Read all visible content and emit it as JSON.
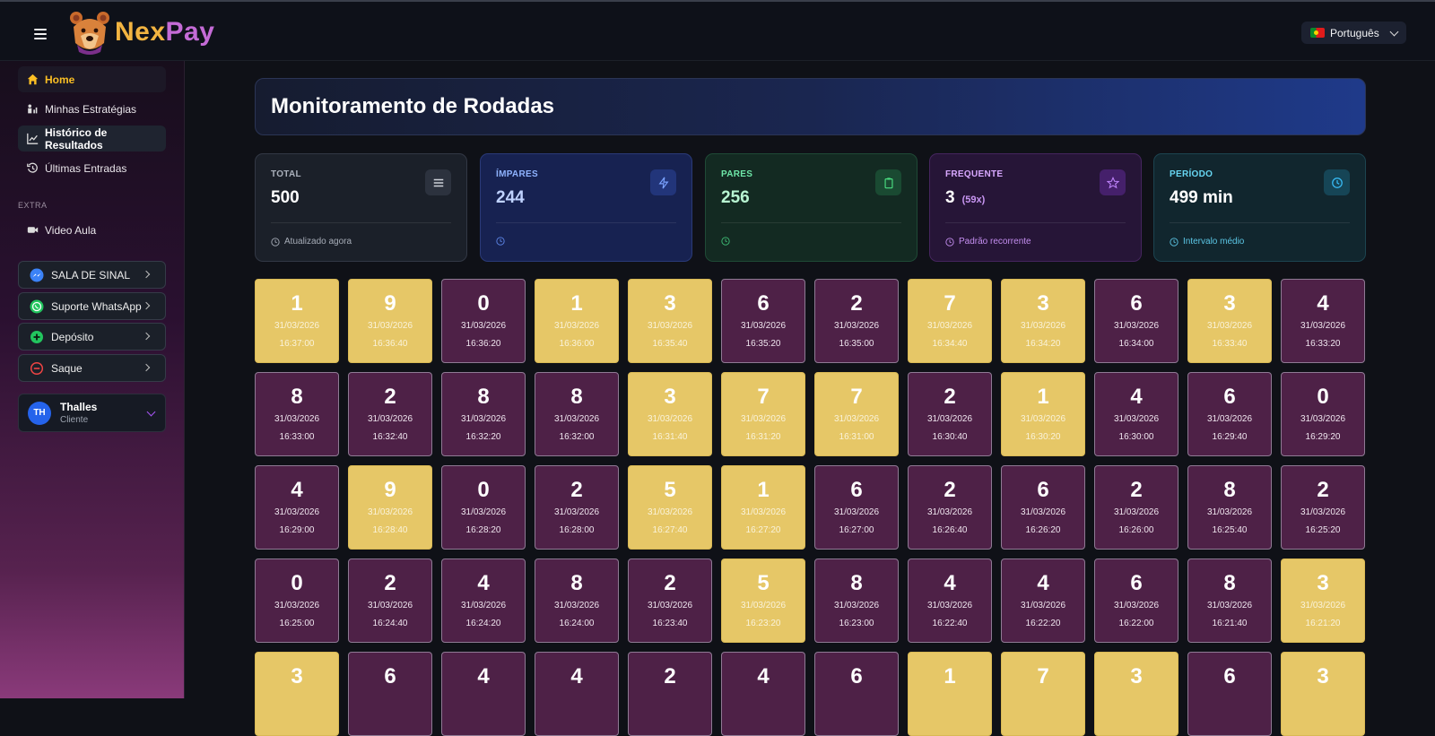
{
  "topbar": {
    "brand_part1": "Nex",
    "brand_part2": "Pay",
    "language": "Português"
  },
  "sidebar": {
    "items": [
      {
        "label": "Home"
      },
      {
        "label": "Minhas Estratégias"
      },
      {
        "label": "Histórico de Resultados"
      },
      {
        "label": "Últimas Entradas"
      }
    ],
    "extra_label": "EXTRA",
    "extra_items": [
      {
        "label": "Video Aula"
      }
    ],
    "actions": [
      {
        "label": "SALA DE SINAL"
      },
      {
        "label": "Suporte WhatsApp"
      },
      {
        "label": "Depósito"
      },
      {
        "label": "Saque"
      }
    ],
    "user": {
      "initials": "TH",
      "name": "Thalles",
      "role": "Cliente"
    }
  },
  "page": {
    "title": "Monitoramento de Rodadas"
  },
  "stats": {
    "total": {
      "label": "TOTAL",
      "value": "500",
      "foot": "Atualizado agora"
    },
    "odd": {
      "label": "ÍMPARES",
      "value": "244"
    },
    "even": {
      "label": "PARES",
      "value": "256"
    },
    "frequent": {
      "label": "FREQUENTE",
      "value": "3",
      "sub": "(59x)",
      "foot": "Padrão recorrente"
    },
    "period": {
      "label": "PERÍODO",
      "value": "499 min",
      "foot": "Intervalo médio"
    }
  },
  "results": [
    {
      "n": "1",
      "date": "31/03/2026",
      "time": "16:37:00"
    },
    {
      "n": "9",
      "date": "31/03/2026",
      "time": "16:36:40"
    },
    {
      "n": "0",
      "date": "31/03/2026",
      "time": "16:36:20"
    },
    {
      "n": "1",
      "date": "31/03/2026",
      "time": "16:36:00"
    },
    {
      "n": "3",
      "date": "31/03/2026",
      "time": "16:35:40"
    },
    {
      "n": "6",
      "date": "31/03/2026",
      "time": "16:35:20"
    },
    {
      "n": "2",
      "date": "31/03/2026",
      "time": "16:35:00"
    },
    {
      "n": "7",
      "date": "31/03/2026",
      "time": "16:34:40"
    },
    {
      "n": "3",
      "date": "31/03/2026",
      "time": "16:34:20"
    },
    {
      "n": "6",
      "date": "31/03/2026",
      "time": "16:34:00"
    },
    {
      "n": "3",
      "date": "31/03/2026",
      "time": "16:33:40"
    },
    {
      "n": "4",
      "date": "31/03/2026",
      "time": "16:33:20"
    },
    {
      "n": "8",
      "date": "31/03/2026",
      "time": "16:33:00"
    },
    {
      "n": "2",
      "date": "31/03/2026",
      "time": "16:32:40"
    },
    {
      "n": "8",
      "date": "31/03/2026",
      "time": "16:32:20"
    },
    {
      "n": "8",
      "date": "31/03/2026",
      "time": "16:32:00"
    },
    {
      "n": "3",
      "date": "31/03/2026",
      "time": "16:31:40"
    },
    {
      "n": "7",
      "date": "31/03/2026",
      "time": "16:31:20"
    },
    {
      "n": "7",
      "date": "31/03/2026",
      "time": "16:31:00"
    },
    {
      "n": "2",
      "date": "31/03/2026",
      "time": "16:30:40"
    },
    {
      "n": "1",
      "date": "31/03/2026",
      "time": "16:30:20"
    },
    {
      "n": "4",
      "date": "31/03/2026",
      "time": "16:30:00"
    },
    {
      "n": "6",
      "date": "31/03/2026",
      "time": "16:29:40"
    },
    {
      "n": "0",
      "date": "31/03/2026",
      "time": "16:29:20"
    },
    {
      "n": "4",
      "date": "31/03/2026",
      "time": "16:29:00"
    },
    {
      "n": "9",
      "date": "31/03/2026",
      "time": "16:28:40"
    },
    {
      "n": "0",
      "date": "31/03/2026",
      "time": "16:28:20"
    },
    {
      "n": "2",
      "date": "31/03/2026",
      "time": "16:28:00"
    },
    {
      "n": "5",
      "date": "31/03/2026",
      "time": "16:27:40"
    },
    {
      "n": "1",
      "date": "31/03/2026",
      "time": "16:27:20"
    },
    {
      "n": "6",
      "date": "31/03/2026",
      "time": "16:27:00"
    },
    {
      "n": "2",
      "date": "31/03/2026",
      "time": "16:26:40"
    },
    {
      "n": "6",
      "date": "31/03/2026",
      "time": "16:26:20"
    },
    {
      "n": "2",
      "date": "31/03/2026",
      "time": "16:26:00"
    },
    {
      "n": "8",
      "date": "31/03/2026",
      "time": "16:25:40"
    },
    {
      "n": "2",
      "date": "31/03/2026",
      "time": "16:25:20"
    },
    {
      "n": "0",
      "date": "31/03/2026",
      "time": "16:25:00"
    },
    {
      "n": "2",
      "date": "31/03/2026",
      "time": "16:24:40"
    },
    {
      "n": "4",
      "date": "31/03/2026",
      "time": "16:24:20"
    },
    {
      "n": "8",
      "date": "31/03/2026",
      "time": "16:24:00"
    },
    {
      "n": "2",
      "date": "31/03/2026",
      "time": "16:23:40"
    },
    {
      "n": "5",
      "date": "31/03/2026",
      "time": "16:23:20"
    },
    {
      "n": "8",
      "date": "31/03/2026",
      "time": "16:23:00"
    },
    {
      "n": "4",
      "date": "31/03/2026",
      "time": "16:22:40"
    },
    {
      "n": "4",
      "date": "31/03/2026",
      "time": "16:22:20"
    },
    {
      "n": "6",
      "date": "31/03/2026",
      "time": "16:22:00"
    },
    {
      "n": "8",
      "date": "31/03/2026",
      "time": "16:21:40"
    },
    {
      "n": "3",
      "date": "31/03/2026",
      "time": "16:21:20"
    },
    {
      "n": "3",
      "date": "",
      "time": ""
    },
    {
      "n": "6",
      "date": "",
      "time": ""
    },
    {
      "n": "4",
      "date": "",
      "time": ""
    },
    {
      "n": "4",
      "date": "",
      "time": ""
    },
    {
      "n": "2",
      "date": "",
      "time": ""
    },
    {
      "n": "4",
      "date": "",
      "time": ""
    },
    {
      "n": "6",
      "date": "",
      "time": ""
    },
    {
      "n": "1",
      "date": "",
      "time": ""
    },
    {
      "n": "7",
      "date": "",
      "time": ""
    },
    {
      "n": "3",
      "date": "",
      "time": ""
    },
    {
      "n": "6",
      "date": "",
      "time": ""
    },
    {
      "n": "3",
      "date": "",
      "time": ""
    }
  ],
  "colors": {
    "odd": "#e6c767",
    "even": "#4e2147",
    "accent": "#fbbf24"
  }
}
